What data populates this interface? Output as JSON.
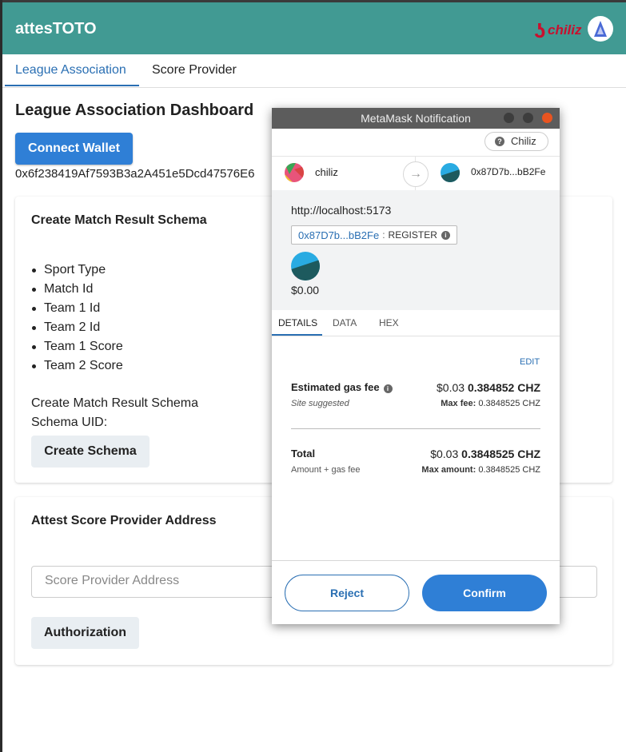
{
  "app": {
    "title": "attesTOTO",
    "logo_text": "chiliz",
    "tabs": [
      {
        "label": "League Association",
        "active": true
      },
      {
        "label": "Score Provider",
        "active": false
      }
    ]
  },
  "dashboard": {
    "title": "League Association Dashboard",
    "connect_wallet_label": "Connect Wallet",
    "wallet_address": "0x6f238419Af7593B3a2A451e5Dcd47576E6"
  },
  "schema_card": {
    "title": "Create Match Result Schema",
    "fields": [
      "Sport Type",
      "Match Id",
      "Team 1 Id",
      "Team 2 Id",
      "Team 1 Score",
      "Team 2 Score"
    ],
    "status_text": "Create Match Result Schema",
    "schema_uid_label": "Schema UID:",
    "button_label": "Create Schema"
  },
  "attest_card": {
    "title": "Attest Score Provider Address",
    "input_placeholder": "Score Provider Address",
    "input_value": "",
    "button_label": "Authorization"
  },
  "metamask": {
    "window_title": "MetaMask Notification",
    "network": "Chiliz",
    "from_account": "chiliz",
    "to_account": "0x87D7b...bB2Fe",
    "origin": "http://localhost:5173",
    "contract_address": "0x87D7b...bB2Fe",
    "method": "REGISTER",
    "value": "$0.00",
    "tabs": [
      "DETAILS",
      "DATA",
      "HEX"
    ],
    "edit_label": "EDIT",
    "gas": {
      "label": "Estimated gas fee",
      "usd": "$0.03",
      "amount": "0.384852 CHZ",
      "site_suggested": "Site suggested",
      "max_fee_label": "Max fee:",
      "max_fee": "0.3848525 CHZ"
    },
    "total": {
      "label": "Total",
      "usd": "$0.03",
      "amount": "0.3848525 CHZ",
      "sub_label": "Amount + gas fee",
      "max_amount_label": "Max amount:",
      "max_amount": "0.3848525 CHZ"
    },
    "reject_label": "Reject",
    "confirm_label": "Confirm"
  },
  "colors": {
    "appbar": "#419a93",
    "primary": "#2f7fd6",
    "link": "#2a6fb3",
    "metamask_close": "#e95420"
  }
}
